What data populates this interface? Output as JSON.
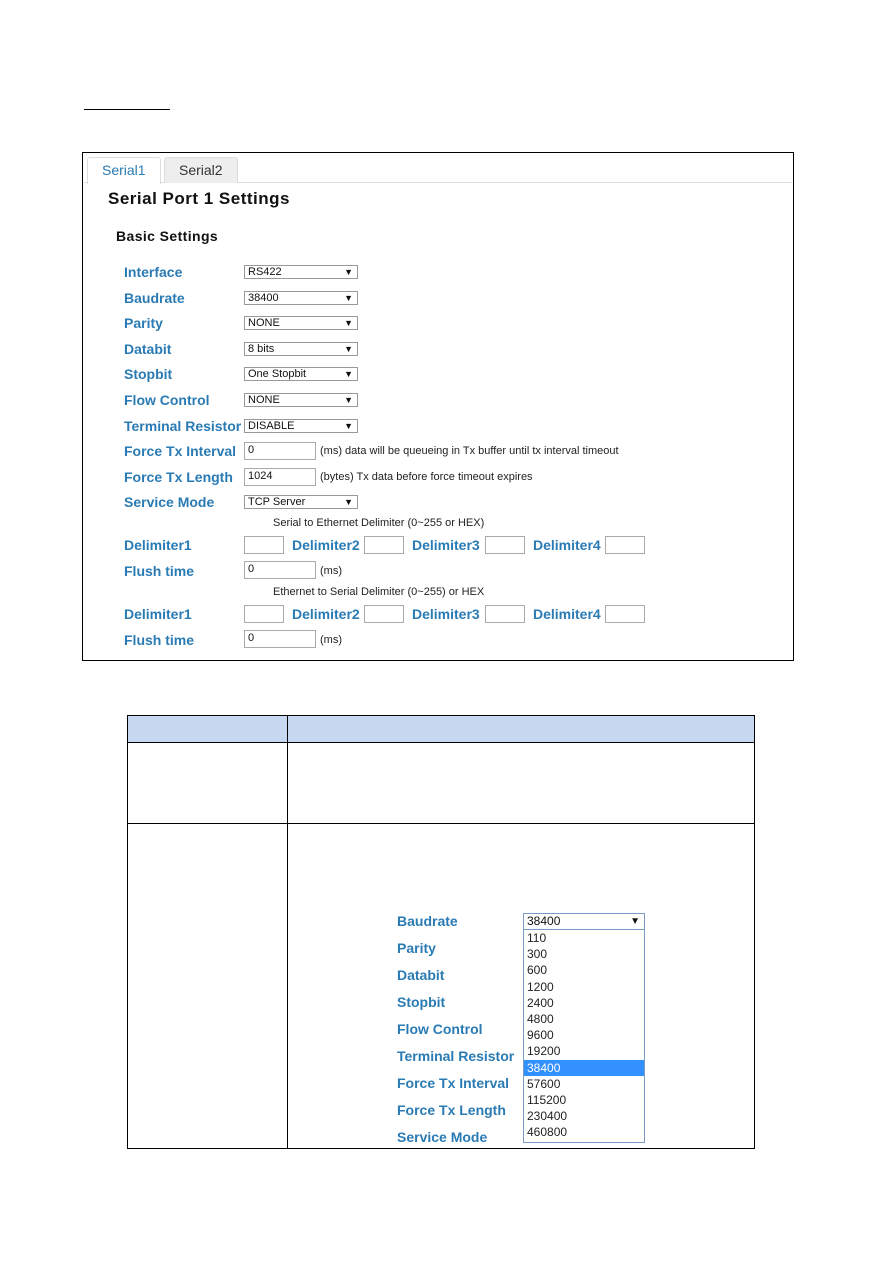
{
  "tabs": [
    {
      "label": "Serial1",
      "active": true
    },
    {
      "label": "Serial2",
      "active": false
    }
  ],
  "title": "Serial Port 1 Settings",
  "section": "Basic Settings",
  "fields": [
    {
      "label": "Interface",
      "type": "select",
      "value": "RS422"
    },
    {
      "label": "Baudrate",
      "type": "select",
      "value": "38400"
    },
    {
      "label": "Parity",
      "type": "select",
      "value": "NONE"
    },
    {
      "label": "Databit",
      "type": "select",
      "value": "8 bits"
    },
    {
      "label": "Stopbit",
      "type": "select",
      "value": "One Stopbit"
    },
    {
      "label": "Flow Control",
      "type": "select",
      "value": "NONE"
    },
    {
      "label": "Terminal Resistor",
      "type": "select",
      "value": "DISABLE"
    },
    {
      "label": "Force Tx Interval",
      "type": "input",
      "value": "0",
      "note": "(ms) data will be queueing in Tx buffer until tx interval timeout"
    },
    {
      "label": "Force Tx Length",
      "type": "input",
      "value": "1024",
      "note": "(bytes) Tx data before force timeout expires"
    },
    {
      "label": "Service Mode",
      "type": "select",
      "value": "TCP Server"
    }
  ],
  "s2e": {
    "heading": "Serial to Ethernet Delimiter (0~255 or HEX)",
    "delims": [
      "Delimiter1",
      "Delimiter2",
      "Delimiter3",
      "Delimiter4"
    ],
    "flush_label": "Flush time",
    "flush_value": "0",
    "flush_unit": "(ms)"
  },
  "e2s": {
    "heading": "Ethernet to Serial Delimiter (0~255) or HEX",
    "delims": [
      "Delimiter1",
      "Delimiter2",
      "Delimiter3",
      "Delimiter4"
    ],
    "flush_label": "Flush time",
    "flush_value": "0",
    "flush_unit": "(ms)"
  },
  "inset": {
    "labels": [
      "Baudrate",
      "Parity",
      "Databit",
      "Stopbit",
      "Flow Control",
      "Terminal Resistor",
      "Force Tx Interval",
      "Force Tx Length",
      "Service Mode"
    ],
    "selected": "38400",
    "options": [
      "110",
      "300",
      "600",
      "1200",
      "2400",
      "4800",
      "9600",
      "19200",
      "38400",
      "57600",
      "115200",
      "230400",
      "460800"
    ]
  },
  "colors": {
    "label": "#2a7bb4",
    "table_header": "#c6d9f1",
    "highlight": "#3390ff"
  }
}
